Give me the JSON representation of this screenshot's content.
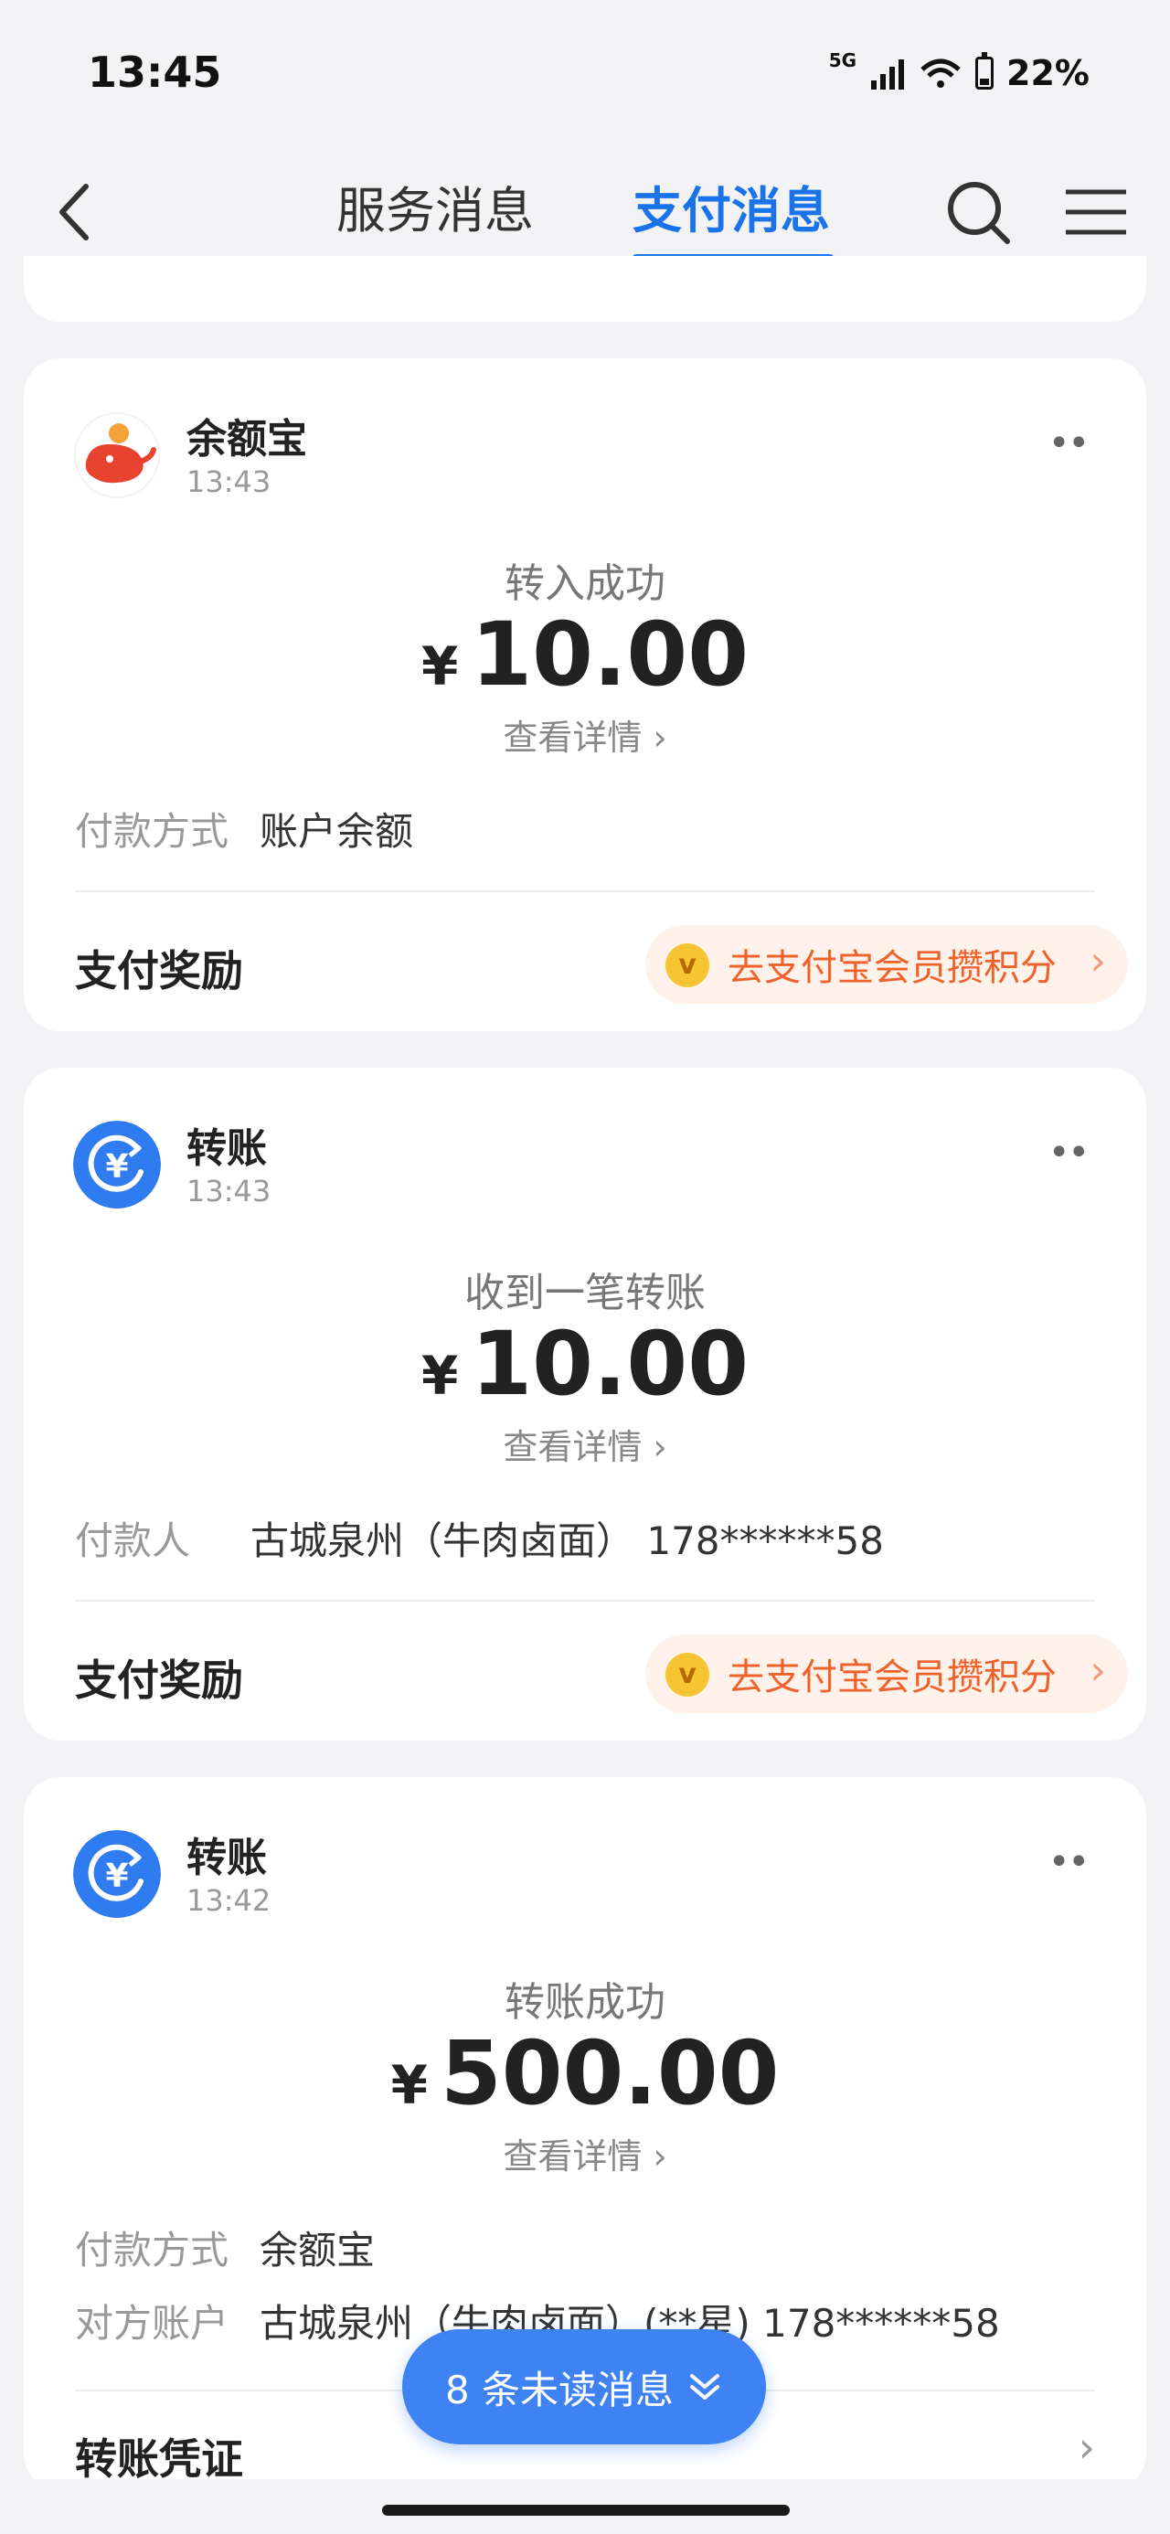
{
  "status_bar": {
    "time": "13:45",
    "network": "5G",
    "battery": "22%"
  },
  "nav": {
    "tabs": [
      {
        "label": "服务消息"
      },
      {
        "label": "支付消息"
      }
    ]
  },
  "cards": [
    {
      "name": "余额宝",
      "time": "13:43",
      "more": "••",
      "headline": "转入成功",
      "currency": "¥",
      "amount": "10.00",
      "detail": "查看详情",
      "rows": [
        {
          "label": "付款方式",
          "value": "账户余额"
        }
      ],
      "reward_label": "支付奖励",
      "reward_action": "去支付宝会员攒积分"
    },
    {
      "name": "转账",
      "time": "13:43",
      "more": "••",
      "headline": "收到一笔转账",
      "currency": "¥",
      "amount": "10.00",
      "detail": "查看详情",
      "rows": [
        {
          "label": "付款人",
          "value": "古城泉州（牛肉卤面） 178******58"
        }
      ],
      "reward_label": "支付奖励",
      "reward_action": "去支付宝会员攒积分"
    },
    {
      "name": "转账",
      "time": "13:42",
      "more": "••",
      "headline": "转账成功",
      "currency": "¥",
      "amount": "500.00",
      "detail": "查看详情",
      "rows": [
        {
          "label": "付款方式",
          "value": "余额宝"
        },
        {
          "label": "对方账户",
          "value": "古城泉州（牛肉卤面）(**星) 178******58"
        }
      ],
      "footer_label": "转账凭证"
    }
  ],
  "unread": {
    "label": "8 条未读消息"
  },
  "colors": {
    "accent": "#1677ff",
    "reward": "#f0622b",
    "yuebao": "#e8432e",
    "transfer": "#2f7bf0"
  }
}
